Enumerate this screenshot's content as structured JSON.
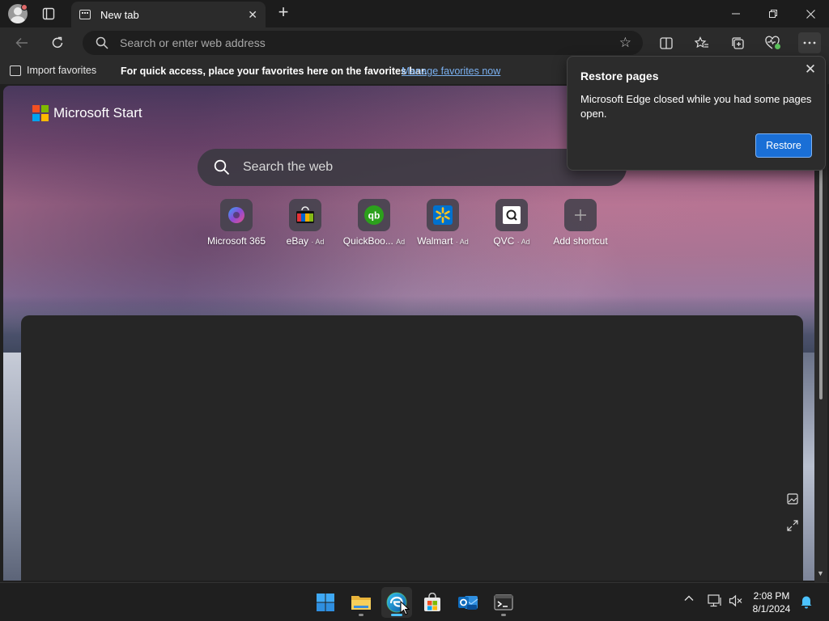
{
  "browser": {
    "tab_title": "New tab",
    "address_placeholder": "Search or enter web address"
  },
  "favorites_bar": {
    "import_label": "Import favorites",
    "message": "For quick access, place your favorites here on the favorites bar.",
    "manage_link": "Manage favorites now"
  },
  "new_tab_page": {
    "brand": "Microsoft Start",
    "search_placeholder": "Search the web",
    "shortcuts": [
      {
        "label": "Microsoft 365",
        "ad": ""
      },
      {
        "label": "eBay",
        "ad": "· Ad"
      },
      {
        "label": "QuickBoo...",
        "ad": "Ad"
      },
      {
        "label": "Walmart",
        "ad": "· Ad"
      },
      {
        "label": "QVC",
        "ad": "· Ad"
      },
      {
        "label": "Add shortcut",
        "ad": ""
      }
    ]
  },
  "restore_popup": {
    "title": "Restore pages",
    "message": "Microsoft Edge closed while you had some pages open.",
    "button": "Restore"
  },
  "taskbar": {
    "time": "2:08 PM",
    "date": "8/1/2024"
  },
  "colors": {
    "accent": "#1a6fd6",
    "link": "#7ab0f0"
  }
}
